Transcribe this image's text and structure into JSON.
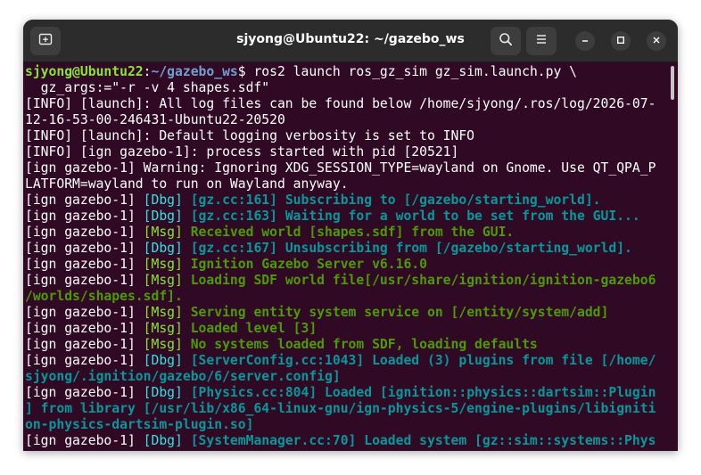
{
  "window": {
    "title": "sjyong@Ubuntu22: ~/gazebo_ws"
  },
  "icons": {
    "new_tab": "new-tab-icon",
    "search": "search-icon",
    "menu": "hamburger-menu-icon",
    "minimize": "minimize-icon",
    "maximize": "maximize-icon",
    "close": "close-icon"
  },
  "colors": {
    "terminal_bg": "#300a24",
    "titlebar_bg": "#2c2c2c",
    "prompt_user": "#8ae234",
    "prompt_path": "#729fcf",
    "dbg_text": "#06989a",
    "msg_text": "#4e9a06"
  },
  "terminal": {
    "prompt": {
      "user_host": "sjyong@Ubuntu22",
      "colon": ":",
      "path": "~/gazebo_ws",
      "symbol": "$",
      "command": " ros2 launch ros_gz_sim gz_sim.launch.py \\",
      "continuation": "  gz_args:=\"-r -v 4 shapes.sdf\""
    },
    "lines": [
      {
        "kind": "plain",
        "text": "[INFO] [launch]: All log files can be found below /home/sjyong/.ros/log/2026-07-"
      },
      {
        "kind": "plain",
        "text": "12-16-53-00-246431-Ubuntu22-20520"
      },
      {
        "kind": "plain",
        "text": "[INFO] [launch]: Default logging verbosity is set to INFO"
      },
      {
        "kind": "plain",
        "text": "[INFO] [ign gazebo-1]: process started with pid [20521]"
      },
      {
        "kind": "plain",
        "text": "[ign gazebo-1] Warning: Ignoring XDG_SESSION_TYPE=wayland on Gnome. Use QT_QPA_P"
      },
      {
        "kind": "plain",
        "text": "LATFORM=wayland to run on Wayland anyway."
      },
      {
        "kind": "log",
        "prefix": "[ign gazebo-1] ",
        "level": "[Dbg]",
        "color": "dbg",
        "message": " [gz.cc:161] Subscribing to [/gazebo/starting_world]."
      },
      {
        "kind": "log",
        "prefix": "[ign gazebo-1] ",
        "level": "[Dbg]",
        "color": "dbg",
        "message": " [gz.cc:163] Waiting for a world to be set from the GUI..."
      },
      {
        "kind": "log",
        "prefix": "[ign gazebo-1] ",
        "level": "[Msg]",
        "color": "msg",
        "message": " Received world [shapes.sdf] from the GUI."
      },
      {
        "kind": "log",
        "prefix": "[ign gazebo-1] ",
        "level": "[Dbg]",
        "color": "dbg",
        "message": " [gz.cc:167] Unsubscribing from [/gazebo/starting_world]."
      },
      {
        "kind": "log",
        "prefix": "[ign gazebo-1] ",
        "level": "[Msg]",
        "color": "msg",
        "message": " Ignition Gazebo Server v6.16.0"
      },
      {
        "kind": "log",
        "prefix": "[ign gazebo-1] ",
        "level": "[Msg]",
        "color": "msg",
        "message": " Loading SDF world file[/usr/share/ignition/ignition-gazebo6"
      },
      {
        "kind": "cont",
        "color": "msg",
        "text": "/worlds/shapes.sdf]."
      },
      {
        "kind": "log",
        "prefix": "[ign gazebo-1] ",
        "level": "[Msg]",
        "color": "msg",
        "message": " Serving entity system service on [/entity/system/add]"
      },
      {
        "kind": "log",
        "prefix": "[ign gazebo-1] ",
        "level": "[Msg]",
        "color": "msg",
        "message": " Loaded level [3]"
      },
      {
        "kind": "log",
        "prefix": "[ign gazebo-1] ",
        "level": "[Msg]",
        "color": "msg",
        "message": " No systems loaded from SDF, loading defaults"
      },
      {
        "kind": "log",
        "prefix": "[ign gazebo-1] ",
        "level": "[Dbg]",
        "color": "dbg",
        "message": " [ServerConfig.cc:1043] Loaded (3) plugins from file [/home/"
      },
      {
        "kind": "cont",
        "color": "dbg",
        "text": "sjyong/.ignition/gazebo/6/server.config]"
      },
      {
        "kind": "log",
        "prefix": "[ign gazebo-1] ",
        "level": "[Dbg]",
        "color": "dbg",
        "message": " [Physics.cc:804] Loaded [ignition::physics::dartsim::Plugin"
      },
      {
        "kind": "cont",
        "color": "dbg",
        "text": "] from library [/usr/lib/x86_64-linux-gnu/ign-physics-5/engine-plugins/libigniti"
      },
      {
        "kind": "cont",
        "color": "dbg",
        "text": "on-physics-dartsim-plugin.so]"
      },
      {
        "kind": "log",
        "prefix": "[ign gazebo-1] ",
        "level": "[Dbg]",
        "color": "dbg",
        "message": " [SystemManager.cc:70] Loaded system [gz::sim::systems::Phys"
      }
    ]
  }
}
